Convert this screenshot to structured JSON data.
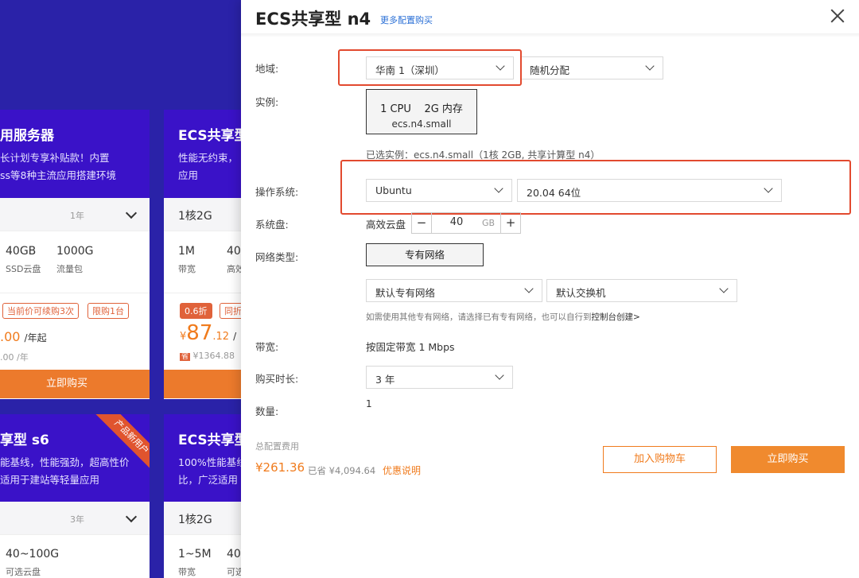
{
  "background": {
    "cards": [
      {
        "title": "用服务器",
        "desc": [
          "长计划专享补贴款！内置",
          "ss等8种主流应用搭建环境"
        ],
        "duration": "1年",
        "specs": [
          {
            "value": "40GB",
            "label": "SSD云盘"
          },
          {
            "value": "1000G",
            "label": "流量包"
          }
        ],
        "tags": [
          "当前价可续购3次",
          "限购1台"
        ],
        "price": ".00",
        "price_unit": "/年起",
        "orig": ".00 /年",
        "buy_label": "立即购买"
      },
      {
        "title": "ECS共享型",
        "desc": [
          "性能无约束，",
          "应用"
        ],
        "config": "1核2G",
        "specs": [
          {
            "value": "1M",
            "label": "带宽"
          },
          {
            "value": "40",
            "label": "高效"
          }
        ],
        "tags": [
          "0.6折",
          "同折"
        ],
        "price_symbol": "¥",
        "price_int": "87",
        "price_dec": ".12",
        "price_suffix": "/",
        "orig_badge": "省",
        "orig": "¥1364.88",
        "buy_label": ""
      },
      {
        "title": "享型 s6",
        "desc": [
          "能基线，性能强劲，超高性价",
          "适用于建站等轻量应用"
        ],
        "duration": "3年",
        "ribbon": "产品新用户",
        "specs": [
          {
            "value": "40~100G",
            "label": "可选云盘"
          }
        ]
      },
      {
        "title": "ECS共享型",
        "desc": [
          "100%性能基线",
          "比，广泛适用"
        ],
        "config": "1核2G",
        "specs": [
          {
            "value": "1~5M",
            "label": "带宽"
          },
          {
            "value": "40",
            "label": "可选"
          }
        ]
      }
    ]
  },
  "dialog": {
    "title": "ECS共享型 n4",
    "more_link": "更多配置购买",
    "region": {
      "label": "地域:",
      "value": "华南 1（深圳）",
      "zone": "随机分配"
    },
    "instance": {
      "label": "实例:",
      "cpu": "1 CPU",
      "mem": "2G 内存",
      "type": "ecs.n4.small",
      "selected": "已选实例：ecs.n4.small（1核 2GB, 共享计算型 n4）"
    },
    "os": {
      "label": "操作系统:",
      "value": "Ubuntu",
      "version": "20.04 64位"
    },
    "disk": {
      "label": "系统盘:",
      "type": "高效云盘",
      "minus": "−",
      "value": "40",
      "unit": "GB",
      "plus": "+"
    },
    "network": {
      "label": "网络类型:",
      "type": "专有网络",
      "vpc": "默认专有网络",
      "vswitch": "默认交换机",
      "hint": "如需使用其他专有网络，请选择已有专有网络，也可以自行到",
      "hint_link": "控制台创建>"
    },
    "bandwidth": {
      "label": "带宽:",
      "value": "按固定带宽 1 Mbps"
    },
    "duration": {
      "label": "购买时长:",
      "value": "3 年"
    },
    "quantity": {
      "label": "数量:",
      "value": "1"
    },
    "fee": {
      "label": "总配置费用",
      "price": "¥261.36",
      "saved": "已省 ¥4,094.64",
      "link": "优惠说明"
    },
    "cart_label": "加入购物车",
    "buy_label": "立即购买"
  },
  "colors": {
    "accent": "#f07b1d",
    "highlight": "#e24a2f",
    "bg": "#2a22a8"
  }
}
